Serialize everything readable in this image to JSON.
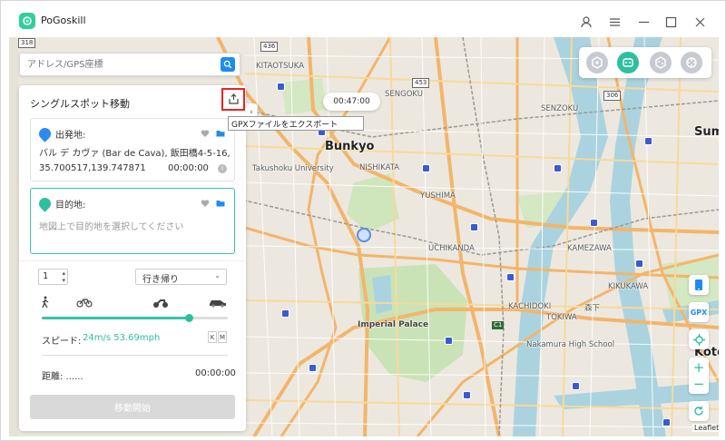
{
  "app": {
    "title": "PoGoskill"
  },
  "search": {
    "placeholder": "アドレス/GPS座標"
  },
  "panel": {
    "title": "シングルスポット移動",
    "tooltip": "GPXファイルをエクスポート",
    "start": {
      "label": "出発地:",
      "address": "バル デ カヴァ (Bar de Cava), 飯田橋4-5-16, ...",
      "coords": "35.700517,139.747871",
      "time": "00:00:00"
    },
    "destination": {
      "label": "目的地:",
      "placeholder": "地図上で目的地を選択してください"
    },
    "count": "1",
    "route_mode": "行き帰り",
    "speed_label": "スピード:",
    "speed_value": "24m/s 53.69mph",
    "unit_k": "K",
    "unit_m": "M",
    "speed_fraction": 0.79,
    "distance_label": "距離: ......",
    "distance_time": "00:00:00",
    "move_button": "移動開始"
  },
  "timer": "00:47:00",
  "tools": {
    "gpx": "GPX"
  },
  "map": {
    "attribution": "Leaflet",
    "places": [
      {
        "name": "KITAOTSUKA",
        "cls": ""
      },
      {
        "name": "SENGOKU",
        "cls": ""
      },
      {
        "name": "Bunkyo",
        "cls": "big"
      },
      {
        "name": "Takushoku University",
        "cls": ""
      },
      {
        "name": "NISHIKATA",
        "cls": ""
      },
      {
        "name": "SENZOKU",
        "cls": ""
      },
      {
        "name": "Sumi",
        "cls": "big"
      },
      {
        "name": "YUSHIMA",
        "cls": ""
      },
      {
        "name": "KAMEZAWA",
        "cls": ""
      },
      {
        "name": "KIKUKAWA",
        "cls": ""
      },
      {
        "name": "Imperial Palace",
        "cls": ""
      },
      {
        "name": "KACHIDOKI",
        "cls": ""
      },
      {
        "name": "TOKIWA",
        "cls": ""
      },
      {
        "name": "Nakamura High School",
        "cls": ""
      },
      {
        "name": "森下",
        "cls": ""
      },
      {
        "name": "Koto",
        "cls": "big"
      },
      {
        "name": "UCHIKANDA",
        "cls": ""
      }
    ],
    "badges": [
      "318",
      "436",
      "453",
      "306",
      "C1"
    ]
  }
}
